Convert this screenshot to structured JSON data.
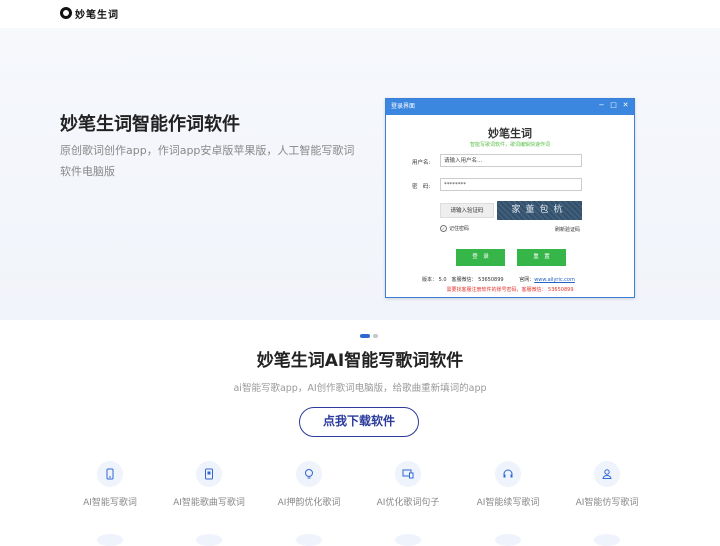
{
  "header": {
    "logo_text": "妙笔生词"
  },
  "hero": {
    "title": "妙笔生词智能作词软件",
    "description": "原创歌词创作app，作词app安卓版苹果版，人工智能写歌词软件电脑版"
  },
  "login_window": {
    "title": "登录界面",
    "app_name": "妙笔生词",
    "slogan": "智能写歌词软件，歌词编辑快速作词",
    "username_label": "用户名:",
    "username_value": "请输入用户名...",
    "password_label": "密　码:",
    "password_value": "********",
    "captcha_button": "请输入验证码",
    "captcha_text": "家董包杭",
    "remember_label": "记住密码",
    "refresh_captcha": "刷新验证码",
    "login_button": "登　录",
    "reset_button": "重　置",
    "version_text": "版本： 5.0　客服微信： 53650899",
    "official_label": "官网：",
    "official_url": "www.ailyric.com",
    "notice": "需要找客服注册软件的账号密码，客服微信： 53650899"
  },
  "carousel": {
    "total": 2,
    "active": 0
  },
  "section": {
    "title": "妙笔生词AI智能写歌词软件",
    "subtitle": "ai智能写歌app，AI创作歌词电脑版，给歌曲重新填词的app",
    "download_button": "点我下载软件"
  },
  "features": [
    {
      "label": "AI智能写歌词",
      "icon": "phone-icon"
    },
    {
      "label": "AI智能歌曲写歌词",
      "icon": "tablet-icon"
    },
    {
      "label": "AI押韵优化歌词",
      "icon": "lightbulb-icon"
    },
    {
      "label": "AI优化歌词句子",
      "icon": "devices-icon"
    },
    {
      "label": "AI智能续写歌词",
      "icon": "headset-icon"
    },
    {
      "label": "AI智能仿写歌词",
      "icon": "user-icon"
    }
  ],
  "colors": {
    "accent": "#2b3b9c",
    "window_titlebar": "#3b87e0",
    "login_green": "#36b548",
    "notice_red": "#e2342d",
    "slogan_green": "#5cc04a",
    "dot_active": "#2f67d6"
  }
}
